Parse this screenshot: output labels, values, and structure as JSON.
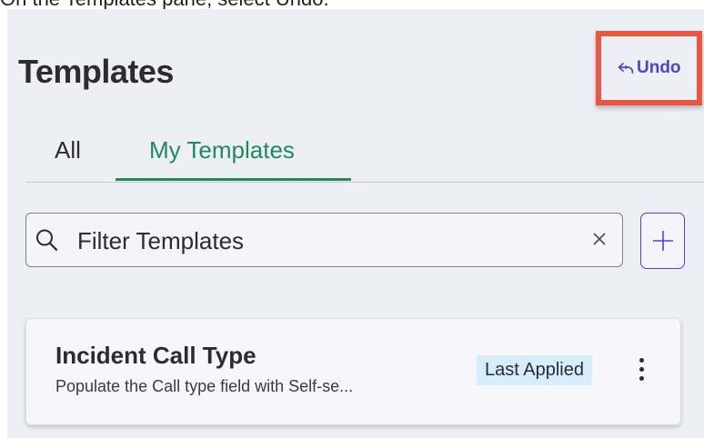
{
  "caption": "On the Templates pane, select Undo.",
  "pane": {
    "title": "Templates",
    "undo_label": "Undo"
  },
  "tabs": [
    {
      "label": "All",
      "active": false
    },
    {
      "label": "My Templates",
      "active": true
    }
  ],
  "search": {
    "placeholder": "Filter Templates",
    "value": ""
  },
  "templates": [
    {
      "title": "Incident Call Type",
      "description": "Populate the Call type field with Self-se...",
      "badge": "Last Applied"
    }
  ],
  "icons": {
    "undo": "undo-arrow-icon",
    "search": "search-icon",
    "clear": "close-icon",
    "add": "plus-icon",
    "menu": "kebab-menu-icon"
  },
  "colors": {
    "accent": "#4b47c6",
    "active_tab": "#1f8a5b",
    "highlight": "#e8573f",
    "badge_bg": "#d6eefb"
  }
}
